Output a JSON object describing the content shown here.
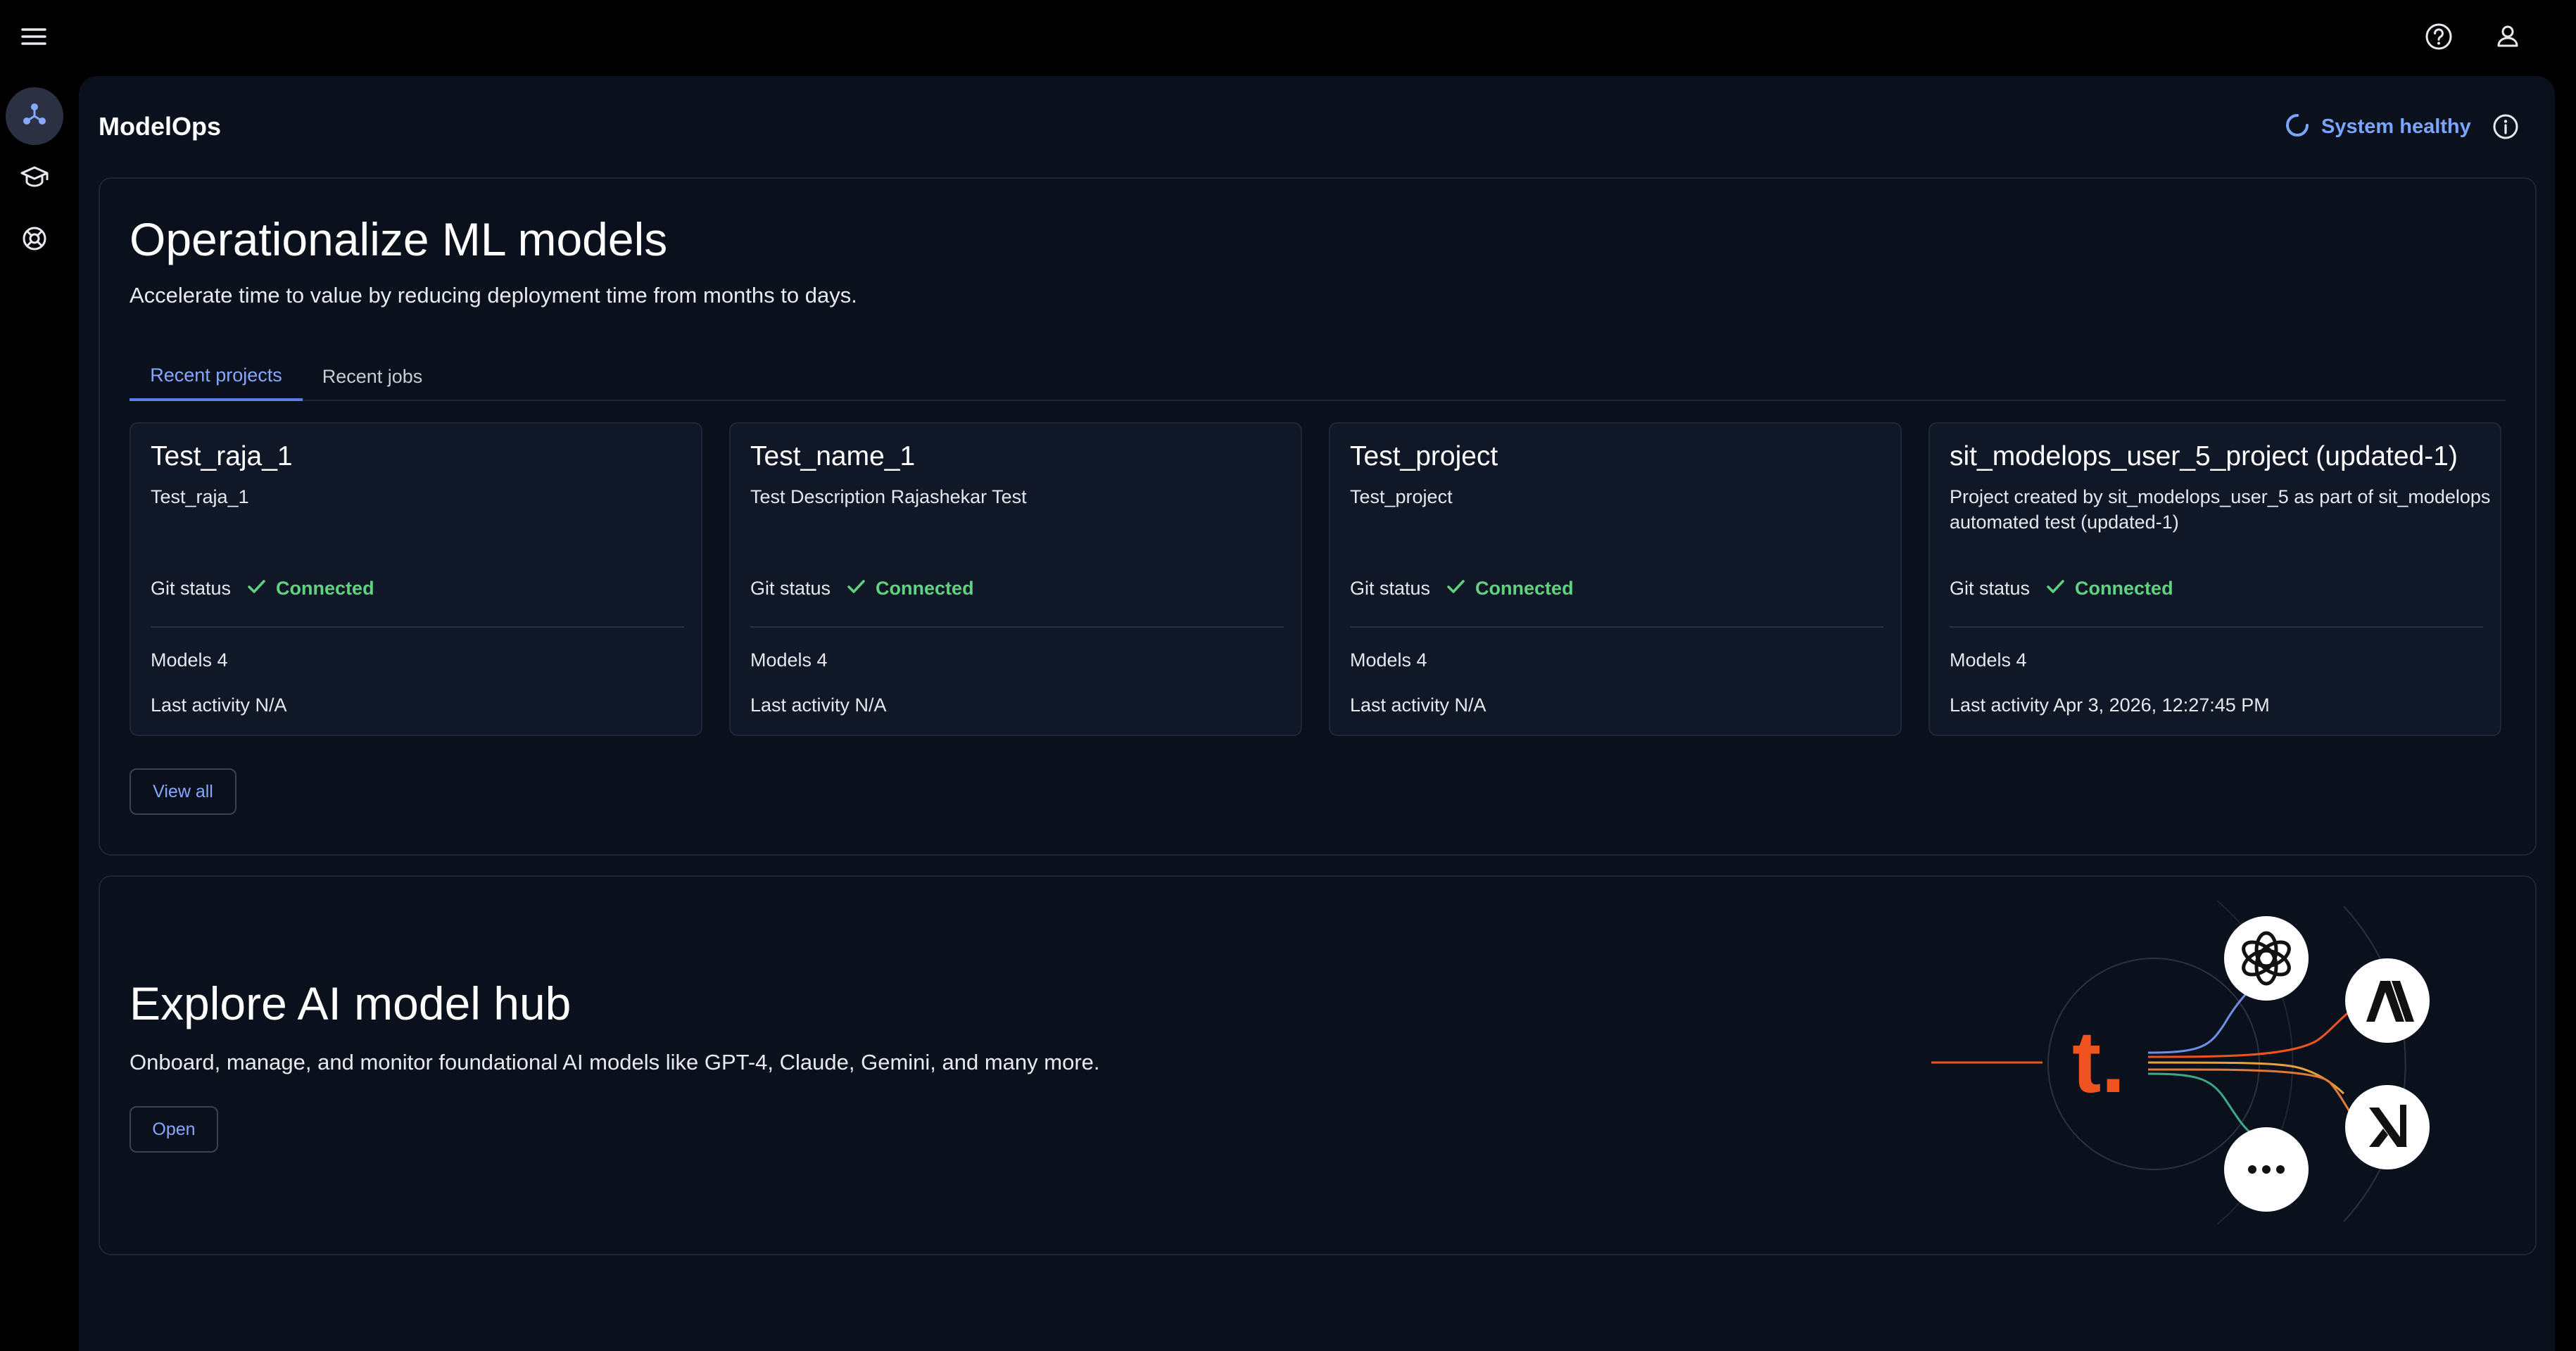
{
  "app": {
    "title": "ModelOps",
    "status": "System healthy",
    "accent_color": "#7aa6ff",
    "connected_color": "#5fd37f",
    "brand_orange": "#f0541e"
  },
  "sidebar": {
    "items": [
      {
        "icon": "model-hub-icon",
        "active": true
      },
      {
        "icon": "graduation-cap-icon",
        "active": false
      },
      {
        "icon": "lifebuoy-icon",
        "active": false
      }
    ]
  },
  "header": {
    "menu_icon": "menu-icon",
    "help_icon": "help-icon",
    "user_icon": "user-icon"
  },
  "hero": {
    "title": "Operationalize ML models",
    "subtitle": "Accelerate time to value by reducing deployment time from months to days."
  },
  "tabs": [
    {
      "label": "Recent projects",
      "active": true
    },
    {
      "label": "Recent jobs",
      "active": false
    }
  ],
  "projects": [
    {
      "title": "Test_raja_1",
      "description": "Test_raja_1",
      "git_label": "Git status",
      "git_status": "Connected",
      "models": "Models 4",
      "last_activity": "Last activity N/A"
    },
    {
      "title": "Test_name_1",
      "description": "Test Description Rajashekar Test",
      "git_label": "Git status",
      "git_status": "Connected",
      "models": "Models 4",
      "last_activity": "Last activity N/A"
    },
    {
      "title": "Test_project",
      "description": "Test_project",
      "git_label": "Git status",
      "git_status": "Connected",
      "models": "Models 4",
      "last_activity": "Last activity N/A"
    },
    {
      "title": "sit_modelops_user_5_project (updated-1)",
      "description": "Project created by sit_modelops_user_5 as part of sit_modelops automated test (updated-1)",
      "git_label": "Git status",
      "git_status": "Connected",
      "models": "Models 4",
      "last_activity": "Last activity Apr 3, 2026, 12:27:45 PM"
    }
  ],
  "view_all_label": "View all",
  "hub": {
    "title": "Explore AI model hub",
    "subtitle": "Onboard, manage, and monitor foundational AI models like GPT-4, Claude, Gemini, and many more.",
    "open_label": "Open",
    "logo_text": "t.",
    "more_text": "···"
  }
}
